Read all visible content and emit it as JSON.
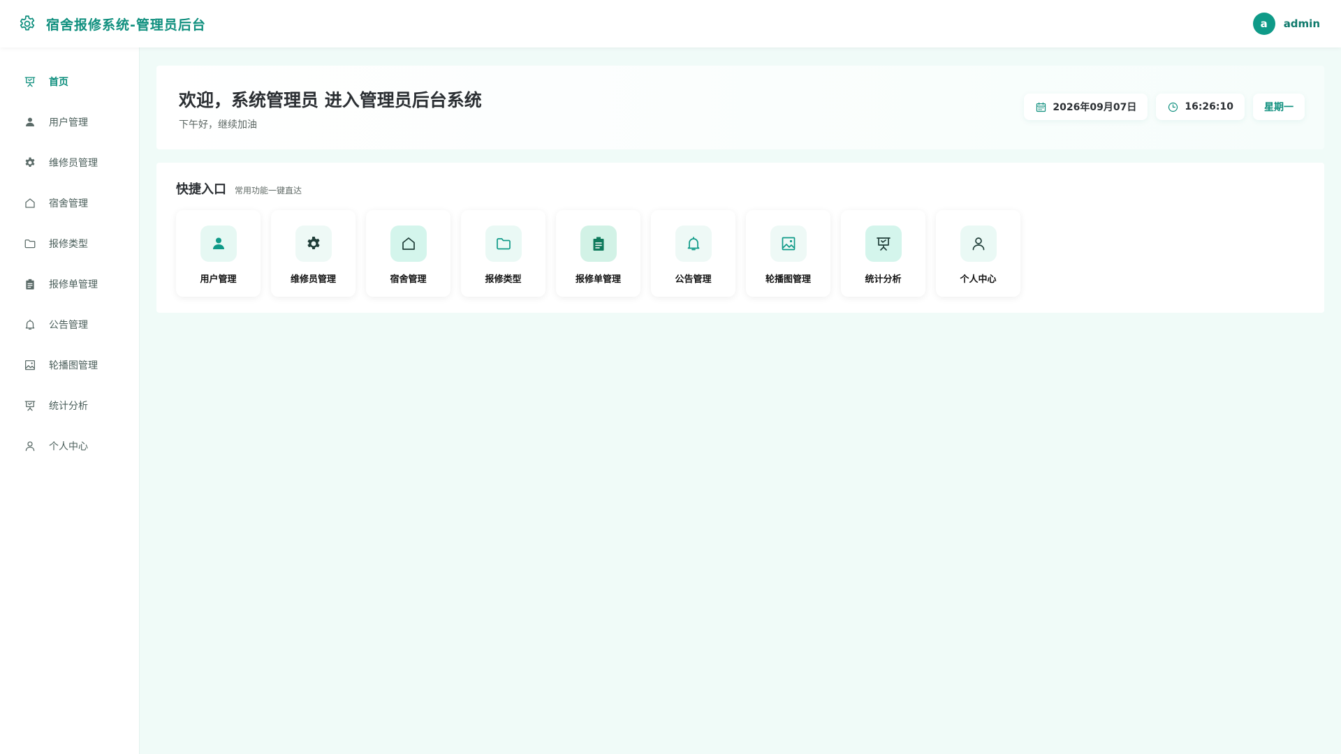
{
  "header": {
    "title": "宿舍报修系统-管理员后台",
    "avatar_letter": "a",
    "username": "admin"
  },
  "sidebar": {
    "items": [
      {
        "label": "首页",
        "icon": "presentation-icon",
        "active": true
      },
      {
        "label": "用户管理",
        "icon": "user-filled-icon"
      },
      {
        "label": "维修员管理",
        "icon": "gear-icon"
      },
      {
        "label": "宿舍管理",
        "icon": "house-icon"
      },
      {
        "label": "报修类型",
        "icon": "folder-icon"
      },
      {
        "label": "报修单管理",
        "icon": "clipboard-icon"
      },
      {
        "label": "公告管理",
        "icon": "bell-icon"
      },
      {
        "label": "轮播图管理",
        "icon": "picture-icon"
      },
      {
        "label": "统计分析",
        "icon": "presentation-icon"
      },
      {
        "label": "个人中心",
        "icon": "user-outline-icon"
      }
    ]
  },
  "welcome": {
    "title": "欢迎，系统管理员 进入管理员后台系统",
    "subtitle": "下午好，继续加油",
    "date": "2026年09月07日",
    "time": "16:26:10",
    "weekday": "星期一"
  },
  "quick": {
    "title": "快捷入口",
    "subtitle": "常用功能一键直达",
    "cards": [
      {
        "label": "用户管理",
        "icon": "user-filled-icon",
        "bg": "#e6f8f3"
      },
      {
        "label": "维修员管理",
        "icon": "gear-icon",
        "bg": "#eef9f6"
      },
      {
        "label": "宿舍管理",
        "icon": "house-icon",
        "bg": "#d4f5ec"
      },
      {
        "label": "报修类型",
        "icon": "folder-icon",
        "bg": "#eaf9f5"
      },
      {
        "label": "报修单管理",
        "icon": "clipboard-icon",
        "bg": "#d2f2e6"
      },
      {
        "label": "公告管理",
        "icon": "bell-icon",
        "bg": "#eef9f6"
      },
      {
        "label": "轮播图管理",
        "icon": "picture-icon",
        "bg": "#eef9f6"
      },
      {
        "label": "统计分析",
        "icon": "presentation-icon",
        "bg": "#d4f5ec"
      },
      {
        "label": "个人中心",
        "icon": "user-outline-icon",
        "bg": "#eaf9f5"
      }
    ]
  },
  "colors": {
    "accent": "#0f8f7e",
    "background": "#f0fbf8"
  }
}
